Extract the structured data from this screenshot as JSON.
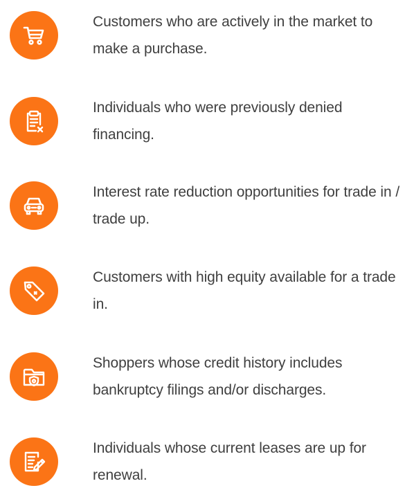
{
  "colors": {
    "accent": "#fb7416",
    "text": "#3f3f3f",
    "icon_stroke": "#ffffff"
  },
  "items": [
    {
      "icon": "shopping-cart-icon",
      "text": "Customers who are actively in the market to make a purchase."
    },
    {
      "icon": "clipboard-denied-icon",
      "text": "Individuals who were previously denied financing."
    },
    {
      "icon": "car-icon",
      "text": "Interest rate reduction opportunities for trade in / trade up."
    },
    {
      "icon": "price-tag-icon",
      "text": "Customers with high equity available for a trade in."
    },
    {
      "icon": "folder-shield-icon",
      "text": "Shoppers whose credit history includes bankruptcy filings and/or discharges."
    },
    {
      "icon": "document-signature-icon",
      "text": "Individuals whose current leases are up for renewal."
    }
  ]
}
